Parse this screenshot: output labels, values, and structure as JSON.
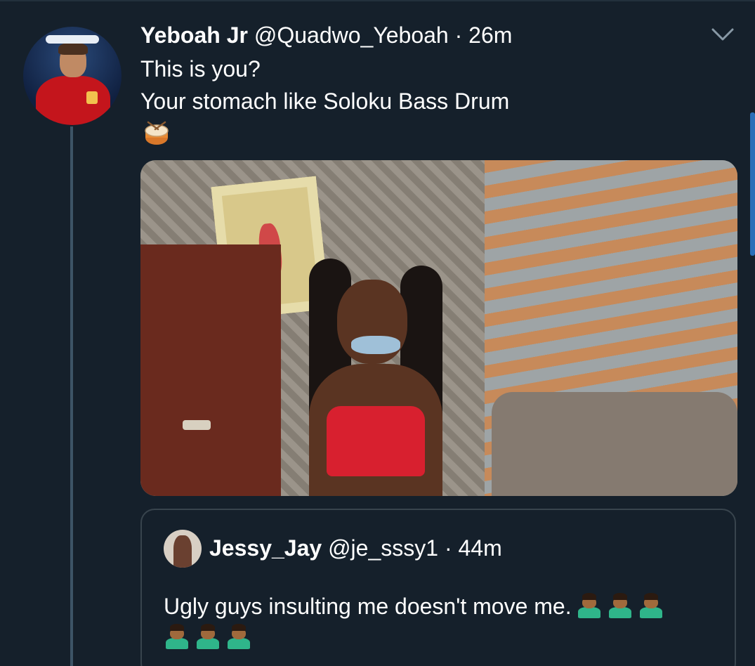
{
  "tweet": {
    "author_name": "Yeboah Jr",
    "author_handle": "@Quadwo_Yeboah",
    "separator": "·",
    "time": "26m",
    "text_line_1": "This is you?",
    "text_line_2": "Your stomach like Soloku Bass Drum",
    "emoji": "drum-emoji",
    "menu_icon": "chevron-down-icon"
  },
  "quoted_tweet": {
    "author_name": "Jessy_Jay",
    "author_handle": "@je_sssy1",
    "separator": "·",
    "time": "44m",
    "text": "Ugly guys insulting me doesn't move me.",
    "emoji": "person-bowing-emoji",
    "emoji_count": 6
  },
  "colors": {
    "background": "#15202b",
    "border": "#38444d",
    "thread_line": "#3d5466"
  }
}
